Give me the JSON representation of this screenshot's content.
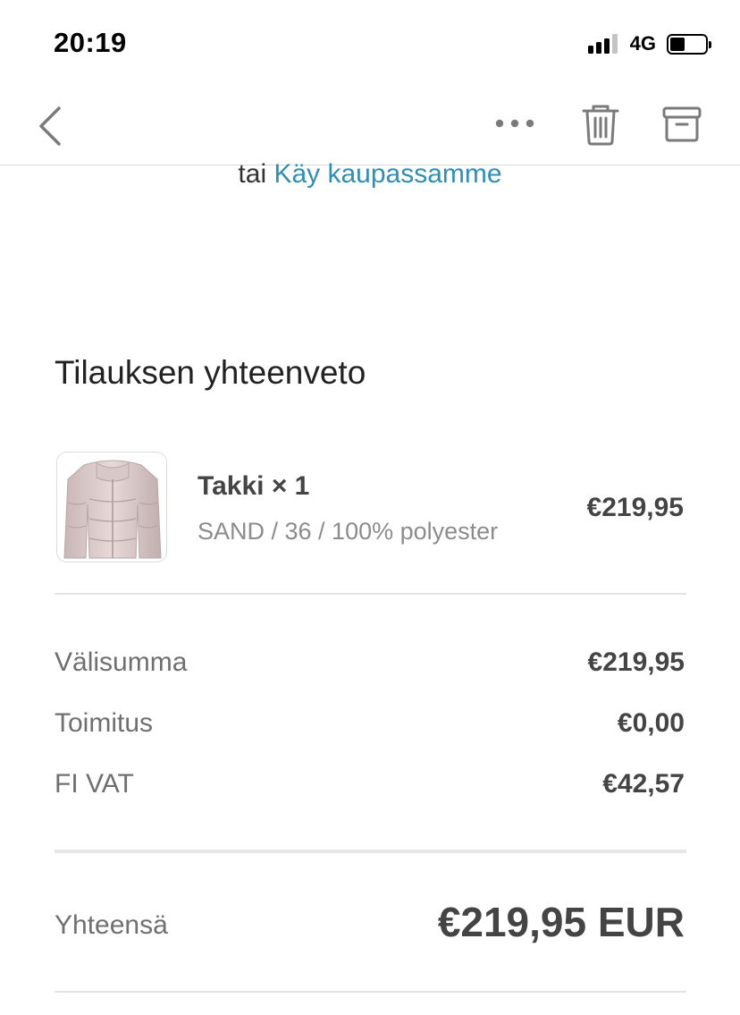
{
  "status_bar": {
    "time": "20:19",
    "network": "4G",
    "signal_bars": 3,
    "battery_level": 0.42,
    "icons": [
      "cellular-signal-icon",
      "battery-icon"
    ]
  },
  "nav": {
    "icons": [
      "chevron-left-icon",
      "more-icon",
      "trash-icon",
      "archive-icon"
    ]
  },
  "email": {
    "shop_prefix": "tai",
    "shop_link": "Käy kaupassamme",
    "summary_title": "Tilauksen yhteenveto",
    "item": {
      "name": "Takki × 1",
      "variant": "SAND / 36 / 100% polyester",
      "price": "€219,95"
    },
    "summary": [
      {
        "label": "Välisumma",
        "value": "€219,95"
      },
      {
        "label": "Toimitus",
        "value": "€0,00"
      },
      {
        "label": "FI VAT",
        "value": "€42,57"
      }
    ],
    "total": {
      "label": "Yhteensä",
      "value": "€219,95 EUR"
    }
  },
  "colors": {
    "link": "#2f8eb4",
    "text_dark": "#444444",
    "text_muted": "#6f6f6f",
    "icon_gray": "#7a7a7a"
  }
}
